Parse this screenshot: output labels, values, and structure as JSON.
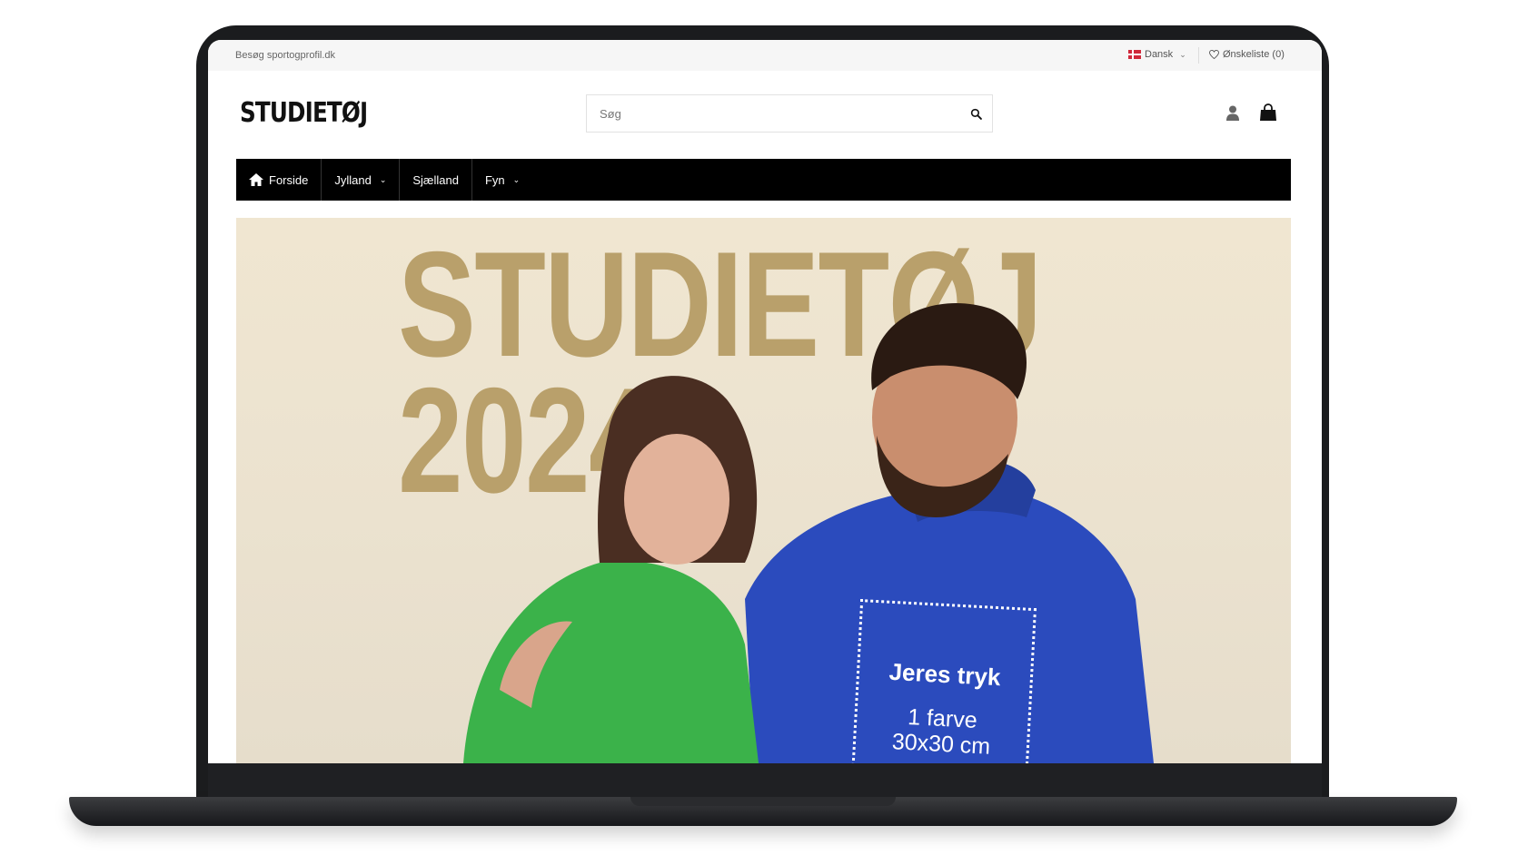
{
  "topbar": {
    "visit_text": "Besøg sportogprofil.dk",
    "language": "Dansk",
    "wishlist": "Ønskeliste (0)"
  },
  "header": {
    "logo": "STUDIETØJ",
    "search_placeholder": "Søg"
  },
  "nav": {
    "items": [
      {
        "label": "Forside",
        "icon": "home-icon"
      },
      {
        "label": "Jylland",
        "dropdown": true
      },
      {
        "label": "Sjælland"
      },
      {
        "label": "Fyn",
        "dropdown": true
      }
    ]
  },
  "hero": {
    "title_line1": "STUDIETØJ",
    "title_line2": "2024",
    "print_title": "Jeres tryk",
    "print_line1": "1 farve",
    "print_line2": "30x30 cm"
  },
  "colors": {
    "nav_bg": "#000000",
    "hero_bg": "#ede3cf",
    "hero_title": "#b9a06b",
    "hoodie_green": "#3bb24a",
    "hoodie_blue": "#2b4bbd"
  }
}
